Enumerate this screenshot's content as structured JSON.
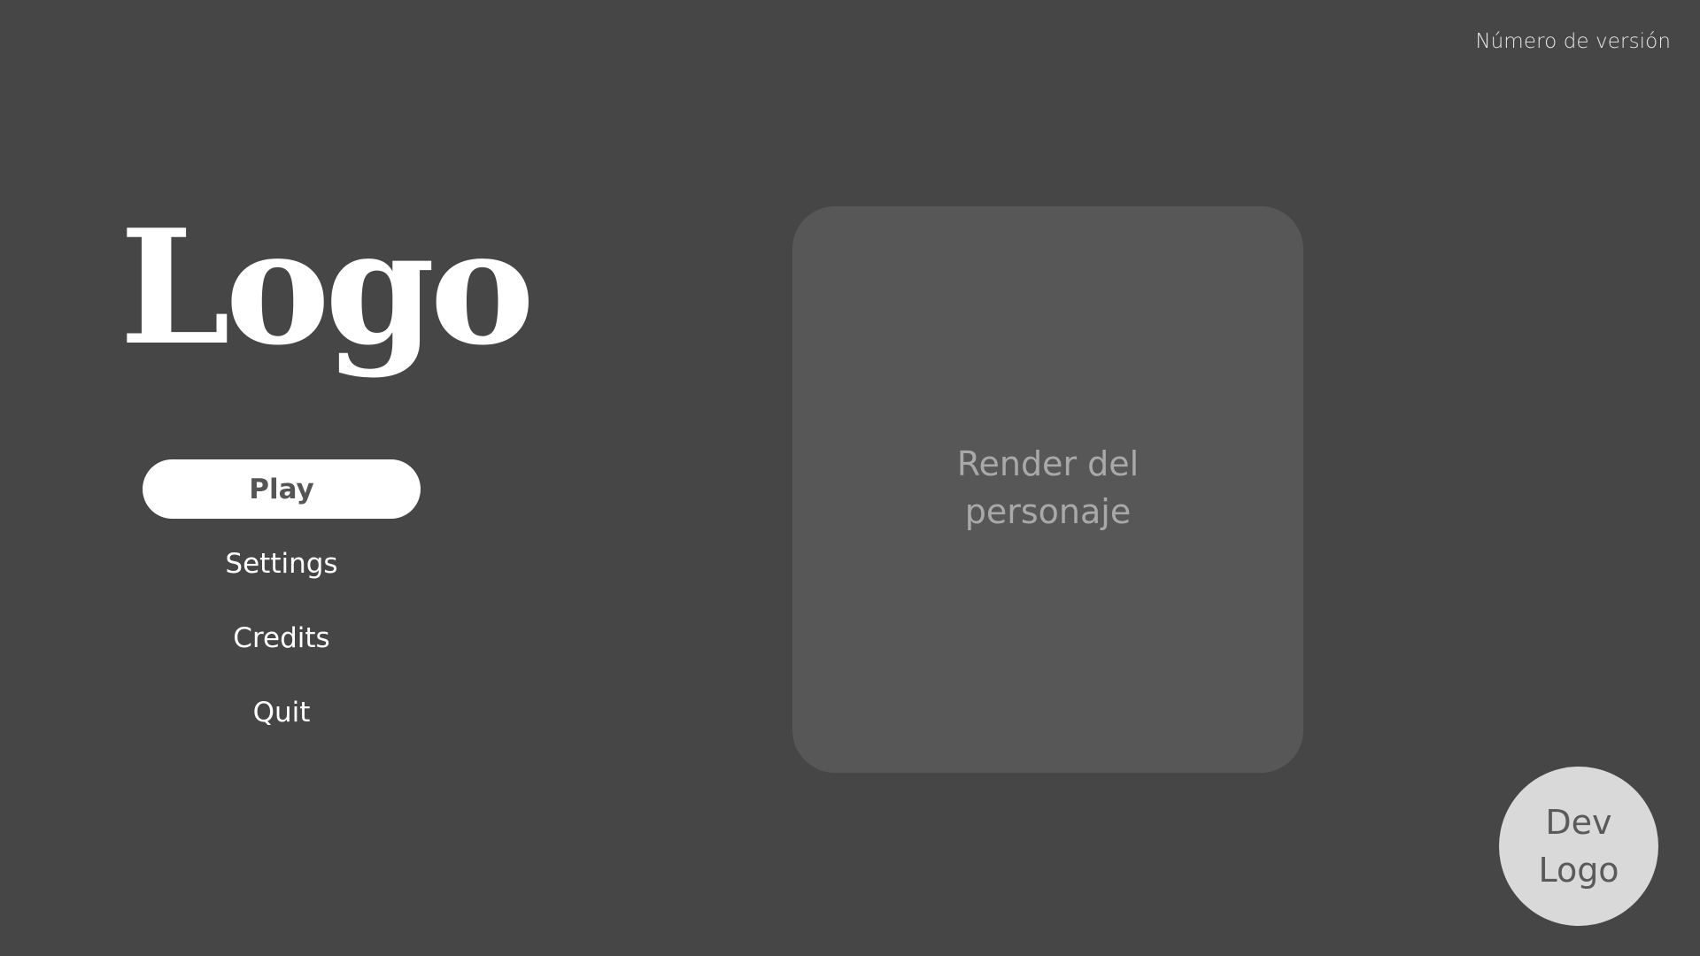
{
  "version": {
    "label": "Número de versión"
  },
  "logo": {
    "text": "Logo"
  },
  "menu": {
    "items": [
      {
        "label": "Play",
        "selected": true
      },
      {
        "label": "Settings",
        "selected": false
      },
      {
        "label": "Credits",
        "selected": false
      },
      {
        "label": "Quit",
        "selected": false
      }
    ]
  },
  "character_render": {
    "label": "Render del personaje"
  },
  "dev_logo": {
    "text": "Dev Logo"
  },
  "colors": {
    "background": "#464646",
    "render_panel": "#575757",
    "selected_button": "#ffffff",
    "dev_logo_circle": "#d9d9d9"
  }
}
